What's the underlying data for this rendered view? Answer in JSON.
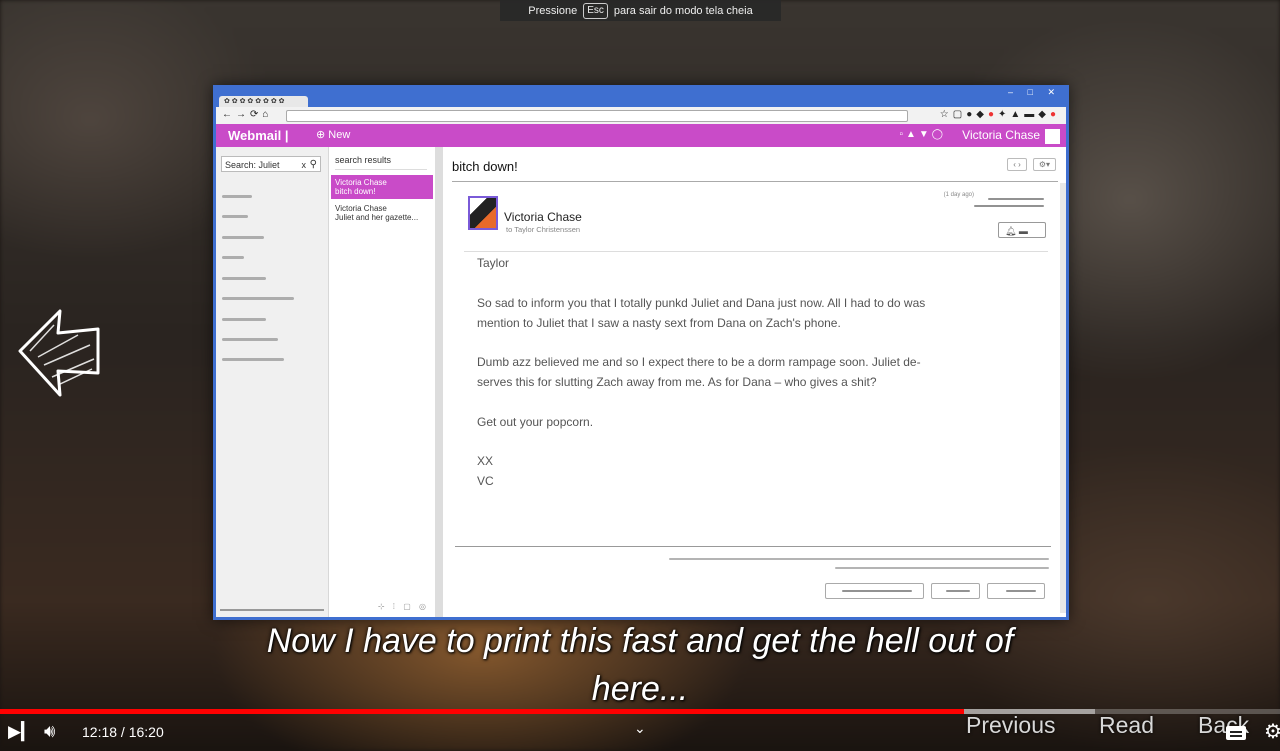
{
  "fullscreen_hint": {
    "before": "Pressione",
    "key": "Esc",
    "after": "para sair do modo tela cheia"
  },
  "browser": {
    "tab_title": "✿ ✿ ✿ ✿ ✿ ✿ ✿ ✿",
    "window_controls": "– □ ✕"
  },
  "webmail": {
    "app_title": "Webmail",
    "new_label": "New",
    "account_name": "Victoria Chase",
    "search_value": "Search: Juliet",
    "results_header": "search results",
    "results": [
      {
        "from": "Victoria Chase",
        "subject": "bitch down!",
        "selected": true
      },
      {
        "from": "Victoria Chase",
        "subject": "Juliet and her gazette...",
        "selected": false
      }
    ]
  },
  "message": {
    "subject": "bitch down!",
    "sender": "Victoria Chase",
    "recipient": "to Taylor Christenssen",
    "date": "(1 day ago)",
    "greeting": "Taylor",
    "lines": [
      "So sad to inform you that I totally punkd Juliet and Dana just now. All I had to do was",
      "mention to Juliet that I saw a nasty sext from Dana on Zach's phone.",
      "Dumb azz believed me and so I expect there to be a dorm rampage soon. Juliet de-",
      "serves this for slutting Zach away from me. As for Dana – who gives a shit?",
      "Get out your popcorn.",
      "XX",
      "VC"
    ]
  },
  "subtitle": {
    "line1": "Now I have to print this fast and get the hell out of",
    "line2": "here..."
  },
  "player": {
    "current_time": "12:18",
    "duration": "16:20",
    "time_display": "12:18 / 16:20",
    "progress": 0.7531,
    "played_color": "#ff0000"
  },
  "game_nav": {
    "previous": "Previous",
    "read": "Read",
    "back": "Back"
  },
  "colors": {
    "webmail_accent": "#c94bc8",
    "window_frame": "#3f6fd0"
  }
}
